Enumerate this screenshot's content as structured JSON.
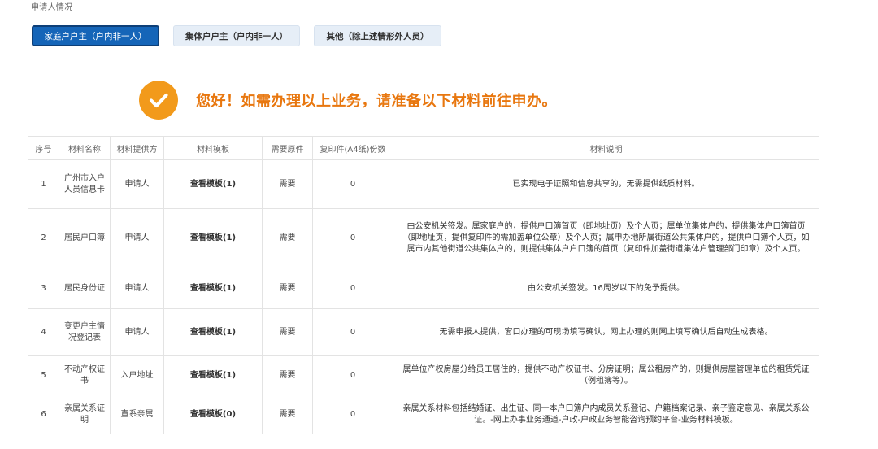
{
  "section": {
    "title": "申请人情况"
  },
  "tabs": [
    {
      "label": "家庭户户主（户内非一人）",
      "active": true
    },
    {
      "label": "集体户户主（户内非一人）",
      "active": false
    },
    {
      "label": "其他（除上述情形外人员）",
      "active": false
    }
  ],
  "notice": {
    "icon": "check-circle-icon",
    "text": "您好！如需办理以上业务，请准备以下材料前往申办。",
    "color": "#e8770f",
    "icon_color": "#f29a1b"
  },
  "table": {
    "headers": {
      "seq": "序号",
      "name": "材料名称",
      "provider": "材料提供方",
      "template": "材料模板",
      "original": "需要原件",
      "copies": "复印件(A4纸)份数",
      "desc": "材料说明"
    },
    "rows": [
      {
        "seq": "1",
        "name": "广州市入户人员信息卡",
        "provider": "申请人",
        "template": "查看模板(1)",
        "original": "需要",
        "copies": "0",
        "desc": "已实现电子证照和信息共享的，无需提供纸质材料。"
      },
      {
        "seq": "2",
        "name": "居民户口簿",
        "provider": "申请人",
        "template": "查看模板(1)",
        "original": "需要",
        "copies": "0",
        "desc": "由公安机关签发。属家庭户的，提供户口簿首页（即地址页）及个人页；属单位集体户的，提供集体户口簿首页（即地址页，提供复印件的需加盖单位公章）及个人页；属申办地所属街道公共集体户的，提供户口簿个人页，如属市内其他街道公共集体户的，则提供集体户户口簿的首页（复印件加盖街道集体户管理部门印章）及个人页。"
      },
      {
        "seq": "3",
        "name": "居民身份证",
        "provider": "申请人",
        "template": "查看模板(1)",
        "original": "需要",
        "copies": "0",
        "desc": "由公安机关签发。16周岁以下的免予提供。"
      },
      {
        "seq": "4",
        "name": "变更户主情况登记表",
        "provider": "申请人",
        "template": "查看模板(1)",
        "original": "需要",
        "copies": "0",
        "desc": "无需申报人提供，窗口办理的可现场填写确认，网上办理的则网上填写确认后自动生成表格。"
      },
      {
        "seq": "5",
        "name": "不动产权证书",
        "provider": "入户地址",
        "template": "查看模板(1)",
        "original": "需要",
        "copies": "0",
        "desc": "属单位产权房屋分给员工居住的，提供不动产权证书、分房证明；属公租房产的，则提供房屋管理单位的租赁凭证（例租簿等）。"
      },
      {
        "seq": "6",
        "name": "亲属关系证明",
        "provider": "直系亲属",
        "template": "查看模板(0)",
        "original": "需要",
        "copies": "0",
        "desc": "亲属关系材料包括结婚证、出生证、同一本户口簿户内成员关系登记、户籍档案记录、亲子鉴定意见、亲属关系公证。-网上办事业务通道-户政-户政业务智能咨询预约平台-业务材料模板。"
      }
    ]
  }
}
